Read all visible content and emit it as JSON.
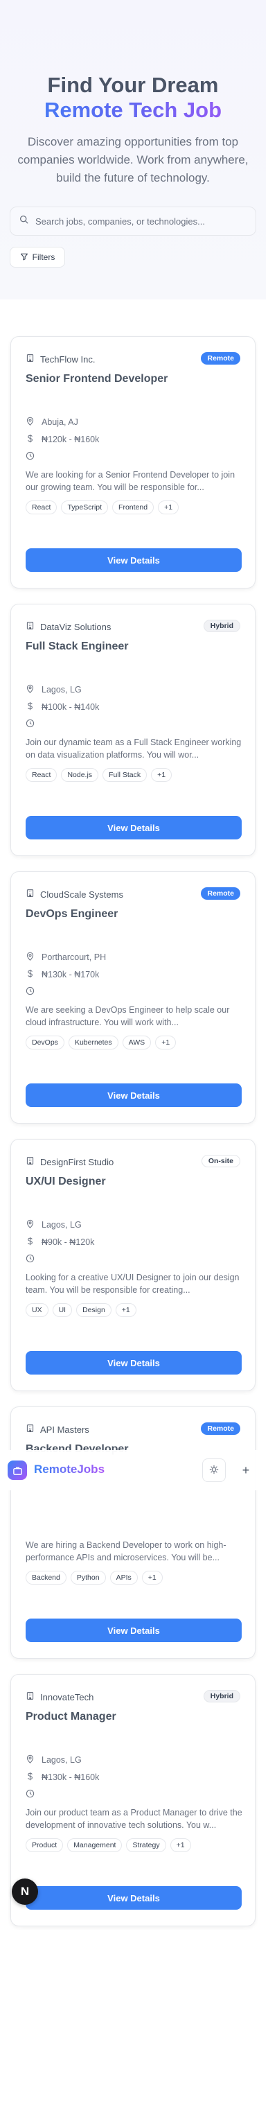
{
  "hero": {
    "title_line1": "Find Your Dream",
    "title_line2": "Remote Tech Job",
    "subtitle": "Discover amazing opportunities from top companies worldwide. Work from anywhere, build the future of technology."
  },
  "search": {
    "placeholder": "Search jobs, companies, or technologies..."
  },
  "filters": {
    "label": "Filters"
  },
  "jobs": [
    {
      "company": "TechFlow Inc.",
      "badge": "Remote",
      "title": "Senior Frontend Developer",
      "location": "Abuja, AJ",
      "salary": "₦120k - ₦160k",
      "description": "We are looking for a Senior Frontend Developer to join our growing team. You will be responsible for...",
      "tags": [
        "React",
        "TypeScript",
        "Frontend",
        "+1"
      ],
      "button": "View Details"
    },
    {
      "company": "DataViz Solutions",
      "badge": "Hybrid",
      "title": "Full Stack Engineer",
      "location": "Lagos, LG",
      "salary": "₦100k - ₦140k",
      "description": "Join our dynamic team as a Full Stack Engineer working on data visualization platforms. You will wor...",
      "tags": [
        "React",
        "Node.js",
        "Full Stack",
        "+1"
      ],
      "button": "View Details"
    },
    {
      "company": "CloudScale Systems",
      "badge": "Remote",
      "title": "DevOps Engineer",
      "location": "Portharcourt, PH",
      "salary": "₦130k - ₦170k",
      "description": "We are seeking a DevOps Engineer to help scale our cloud infrastructure. You will work with...",
      "tags": [
        "DevOps",
        "Kubernetes",
        "AWS",
        "+1"
      ],
      "button": "View Details"
    },
    {
      "company": "DesignFirst Studio",
      "badge": "On-site",
      "title": "UX/UI Designer",
      "location": "Lagos, LG",
      "salary": "₦90k - ₦120k",
      "description": "Looking for a creative UX/UI Designer to join our design team. You will be responsible for creating...",
      "tags": [
        "UX",
        "UI",
        "Design",
        "+1"
      ],
      "button": "View Details"
    },
    {
      "company": "API Masters",
      "badge": "Remote",
      "title": "Backend Developer",
      "location": "",
      "salary": "",
      "description": "We are hiring a Backend Developer to work on high-performance APIs and microservices. You will be...",
      "tags": [
        "Backend",
        "Python",
        "APIs",
        "+1"
      ],
      "button": "View Details"
    },
    {
      "company": "InnovateTech",
      "badge": "Hybrid",
      "title": "Product Manager",
      "location": "Lagos, LG",
      "salary": "₦130k - ₦160k",
      "description": "Join our product team as a Product Manager to drive the development of innovative tech solutions. You w...",
      "tags": [
        "Product",
        "Management",
        "Strategy",
        "+1"
      ],
      "button": "View Details"
    }
  ],
  "navbar": {
    "brand": "RemoteJobs",
    "plus": "+"
  },
  "dev_badge": {
    "letter": "N"
  },
  "colors": {
    "accent": "#3b82f6",
    "gradient_end": "#a855f7"
  }
}
